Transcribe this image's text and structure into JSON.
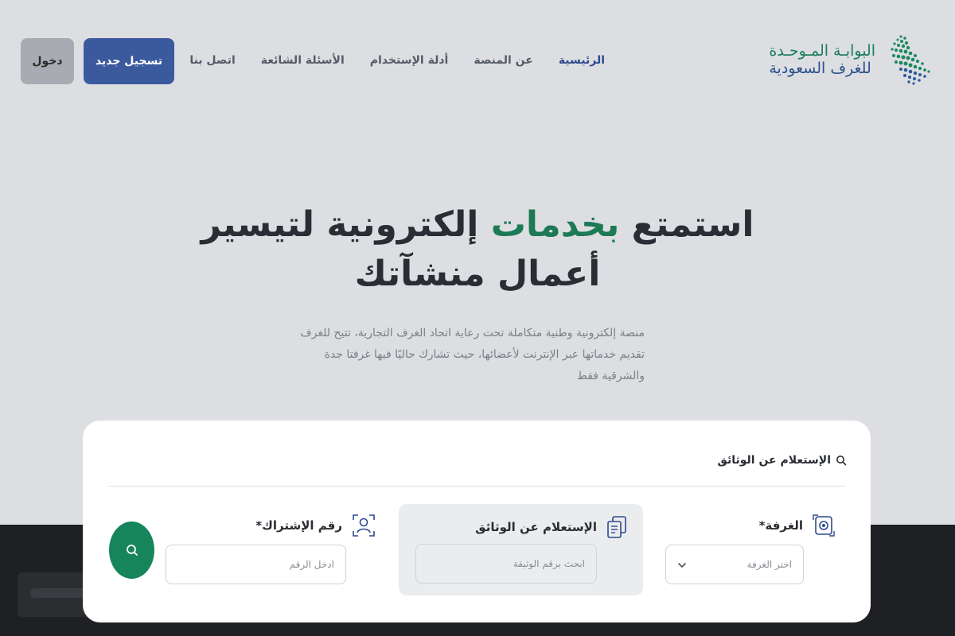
{
  "brand": {
    "line1": "البوابـة المـوحـدة",
    "line2": "للغرف السعودية"
  },
  "nav": {
    "items": [
      {
        "label": "الرئيسية",
        "active": true
      },
      {
        "label": "عن المنصة",
        "active": false
      },
      {
        "label": "أدلة الإستخدام",
        "active": false
      },
      {
        "label": "الأسئلة الشائعة",
        "active": false
      },
      {
        "label": "اتصل بنا",
        "active": false
      }
    ],
    "register_label": "تسجيل جديد",
    "login_label": "دخول"
  },
  "hero": {
    "title_part1": "استمتع ",
    "title_accent": "بخدمات",
    "title_part2": " إلكترونية لتيسير",
    "title_line2": "أعمال منشآتك",
    "description": "منصة إلكترونية وطنية متكاملة تحت رعاية اتحاد الغرف التجارية، تتيح للغرف تقديم خدماتها عبر الإنترنت لأعضائها، حيث تشارك حاليًا فيها غرفتا جدة والشرقية فقط"
  },
  "search_card": {
    "title": "الإستعلام عن الوثائق",
    "chamber": {
      "label": "الغرفة*",
      "placeholder": "اختر الغرفة"
    },
    "document": {
      "label": "الإستعلام عن الوثائق",
      "placeholder": "ابحث برقم الوثيقة"
    },
    "subscription": {
      "label": "رقم الإشتراك*",
      "placeholder": "ادخل الرقم"
    }
  },
  "colors": {
    "primary_blue": "#3b5a9e",
    "accent_green": "#1c7a55",
    "button_green": "#17855b",
    "background": "#dddee2"
  },
  "icons": {
    "search": "search-icon",
    "chamber": "chamber-icon",
    "document": "document-icon",
    "subscription": "user-scan-icon",
    "chevron": "chevron-down-icon"
  }
}
